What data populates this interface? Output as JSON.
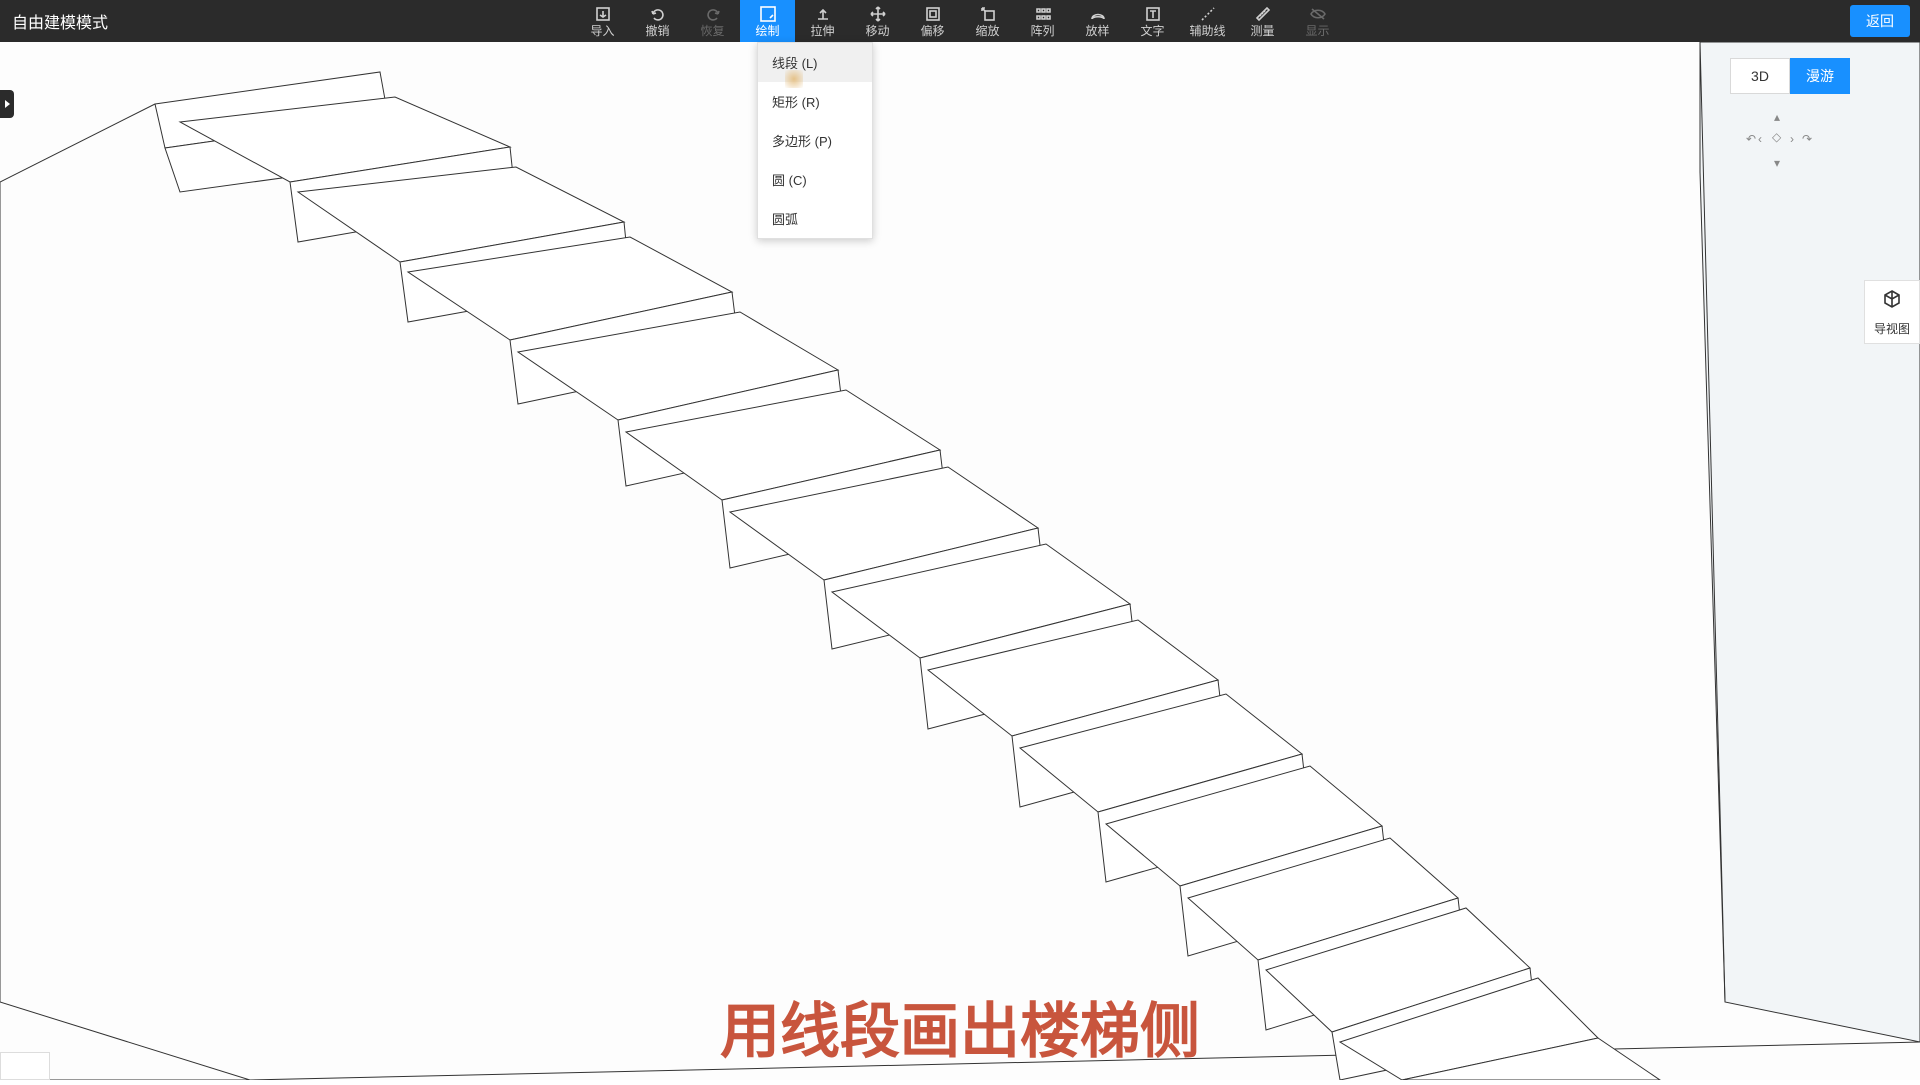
{
  "header": {
    "title": "自由建模模式",
    "return_label": "返回"
  },
  "toolbar": {
    "import": "导入",
    "undo": "撤销",
    "redo": "恢复",
    "draw": "绘制",
    "extrude": "拉伸",
    "move": "移动",
    "offset": "偏移",
    "scale": "缩放",
    "array": "阵列",
    "sample": "放样",
    "text": "文字",
    "guide": "辅助线",
    "measure": "测量",
    "display": "显示"
  },
  "drawMenu": {
    "line": "线段 (L)",
    "rect": "矩形 (R)",
    "polygon": "多边形 (P)",
    "circle": "圆 (C)",
    "arc": "圆弧"
  },
  "view": {
    "mode3d": "3D",
    "roam": "漫游"
  },
  "sidePanel": {
    "label": "导视图"
  },
  "caption": "用线段画出楼梯侧"
}
